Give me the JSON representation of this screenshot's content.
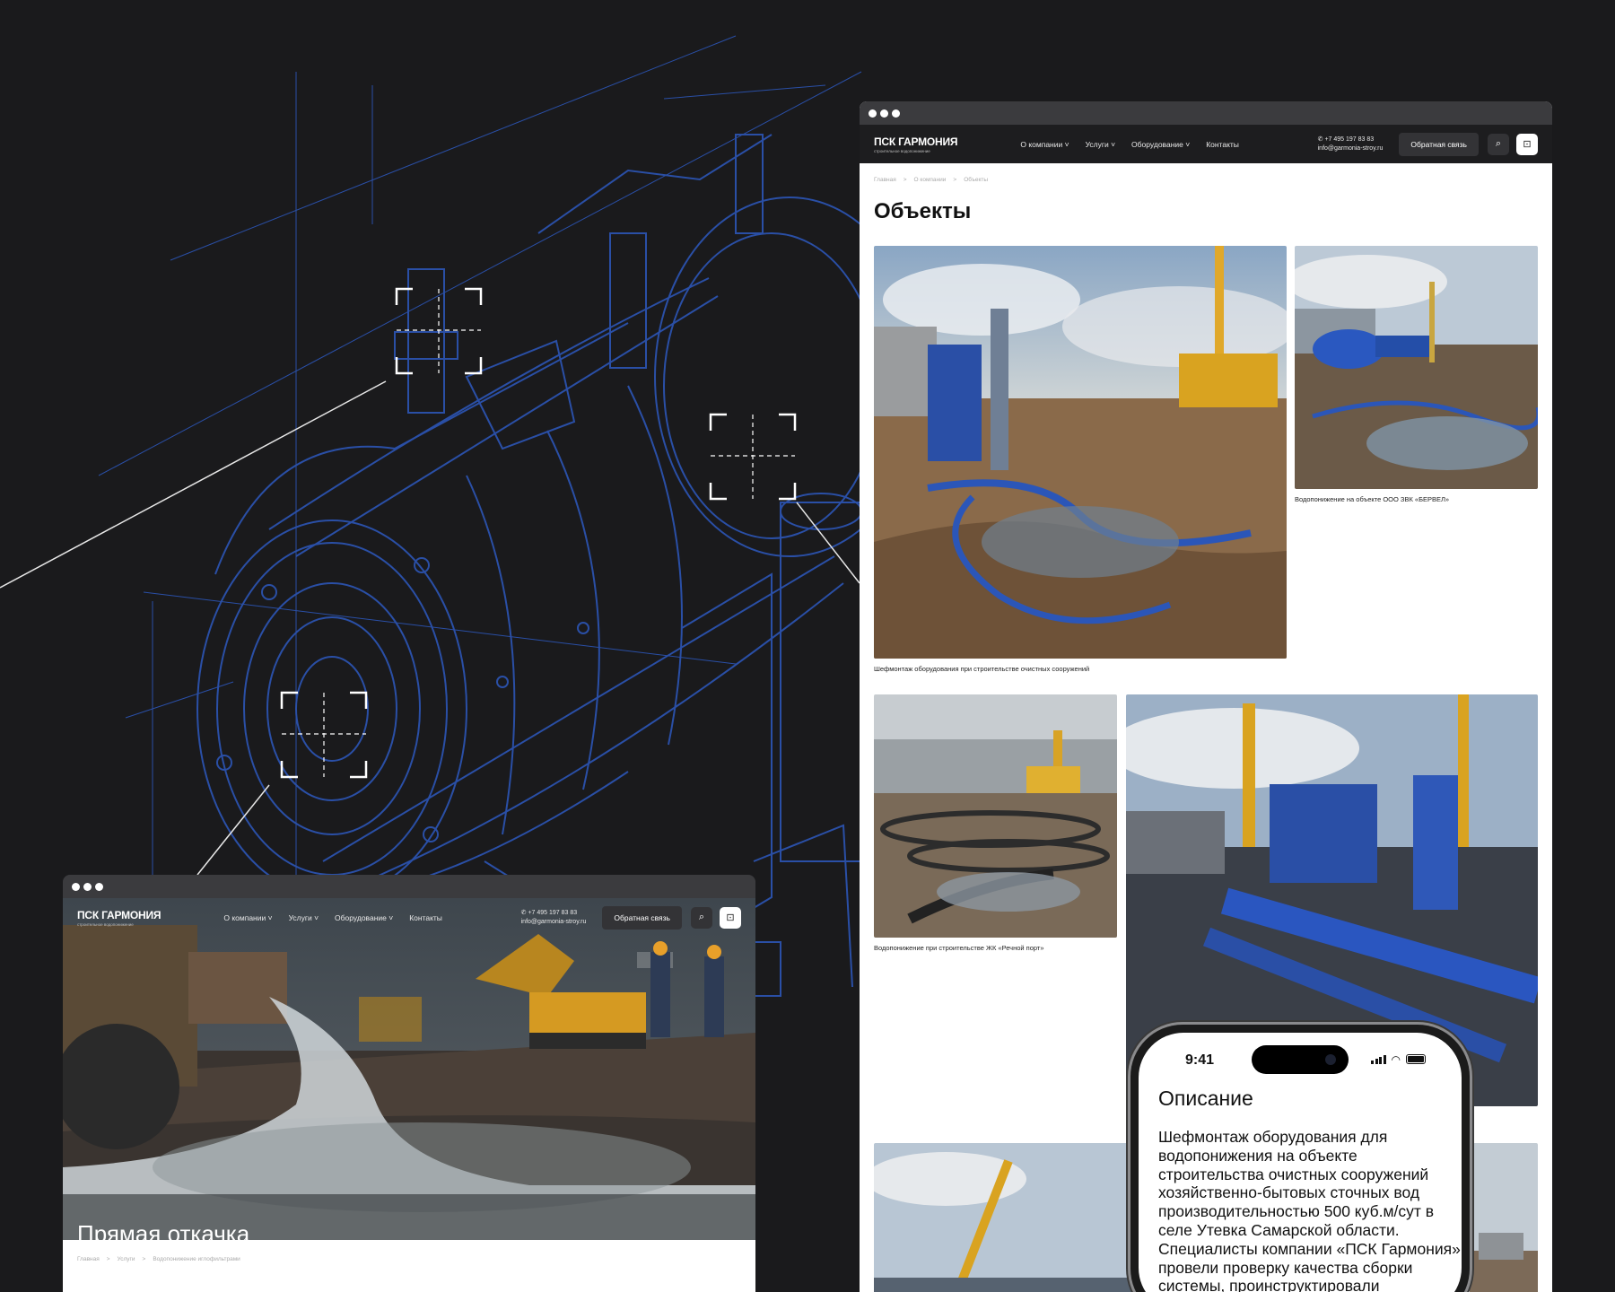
{
  "site": {
    "logo_title": "ПСК ГАРМОНИЯ",
    "logo_subtitle": "строительное водопонижение",
    "menu": [
      {
        "label": "О компании ˅"
      },
      {
        "label": "Услуги ˅"
      },
      {
        "label": "Оборудование ˅"
      },
      {
        "label": "Контакты"
      }
    ],
    "phone": "+7 495 197 83 83",
    "email": "info@garmonia-stroy.ru",
    "feedback_label": "Обратная связь",
    "icons": [
      "whatsapp-icon",
      "search-icon",
      "cart-icon"
    ]
  },
  "objects_page": {
    "breadcrumbs": [
      "Главная",
      ">",
      "О компании",
      ">",
      "Объекты"
    ],
    "title": "Объекты",
    "captions": {
      "obj1": "Шефмонтаж оборудования при строительстве очистных сооружений",
      "obj2": "Водопонижение на объекте ООО ЗВК «БЕРВЕЛ»",
      "obj3": "Водопонижение при строительстве ЖК «Речной порт»"
    }
  },
  "home_page": {
    "hero_title": "Прямая откачка",
    "breadcrumbs": [
      "Главная",
      ">",
      "Услуги",
      ">",
      "Водопонижение иглофильтрами"
    ]
  },
  "phone_screen": {
    "time": "9:41",
    "title": "Описание",
    "text": "Шефмонтаж оборудования для водопонижения на объекте строительства очистных сооружений хозяйственно-бытовых сточных вод производительностью 500 куб.м/сут в селе Утевка Самарской области. Специалисты компании «ПСК Гармония» провели проверку качества сборки системы, проинструктировали"
  },
  "colors": {
    "background": "#1a1a1c",
    "blueprint": "#2a4fa6",
    "nav": "#1d1d1f",
    "button": "#333336"
  }
}
